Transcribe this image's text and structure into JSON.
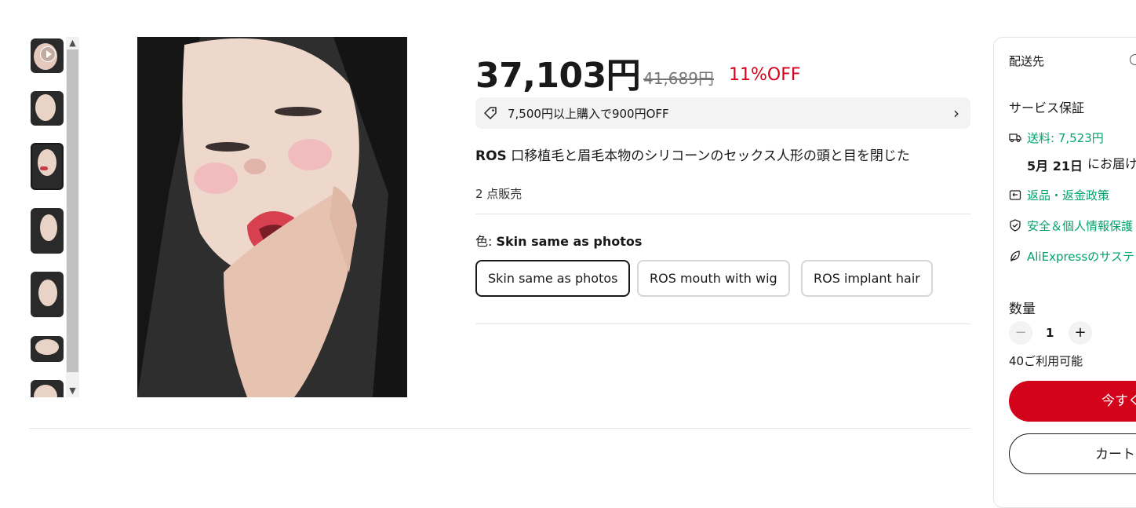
{
  "product": {
    "price": "37,103円",
    "original_price": "41,689円",
    "discount": "11%OFF",
    "coupon_text": "7,500円以上購入で900円OFF",
    "title_brand": "ROS",
    "title_rest": " 口移植毛と眉毛本物のシリコーンのセックス人形の頭と目を閉じた",
    "sold": "2 点販売",
    "color_label": "色: ",
    "color_value": "Skin same as photos",
    "options": [
      "Skin same as photos",
      "ROS mouth with wig",
      "ROS implant hair"
    ]
  },
  "sidebar": {
    "shipping_to": "配送先",
    "service_header": "サービス保証",
    "shipping_fee": "送料: 7,523円",
    "delivery_date": "5月 21日",
    "delivery_suffix": "にお届け",
    "returns": "返品・返金政策",
    "security": "安全＆個人情報保護",
    "sustain": "AliExpressのサステ",
    "qty_label": "数量",
    "qty_minus": "−",
    "qty_value": "1",
    "qty_plus": "+",
    "available": "40ご利用可能",
    "buy_now": "今すぐ",
    "add_cart": "カートに"
  },
  "colors": {
    "accent": "#d3031c",
    "green": "#00a36f"
  }
}
